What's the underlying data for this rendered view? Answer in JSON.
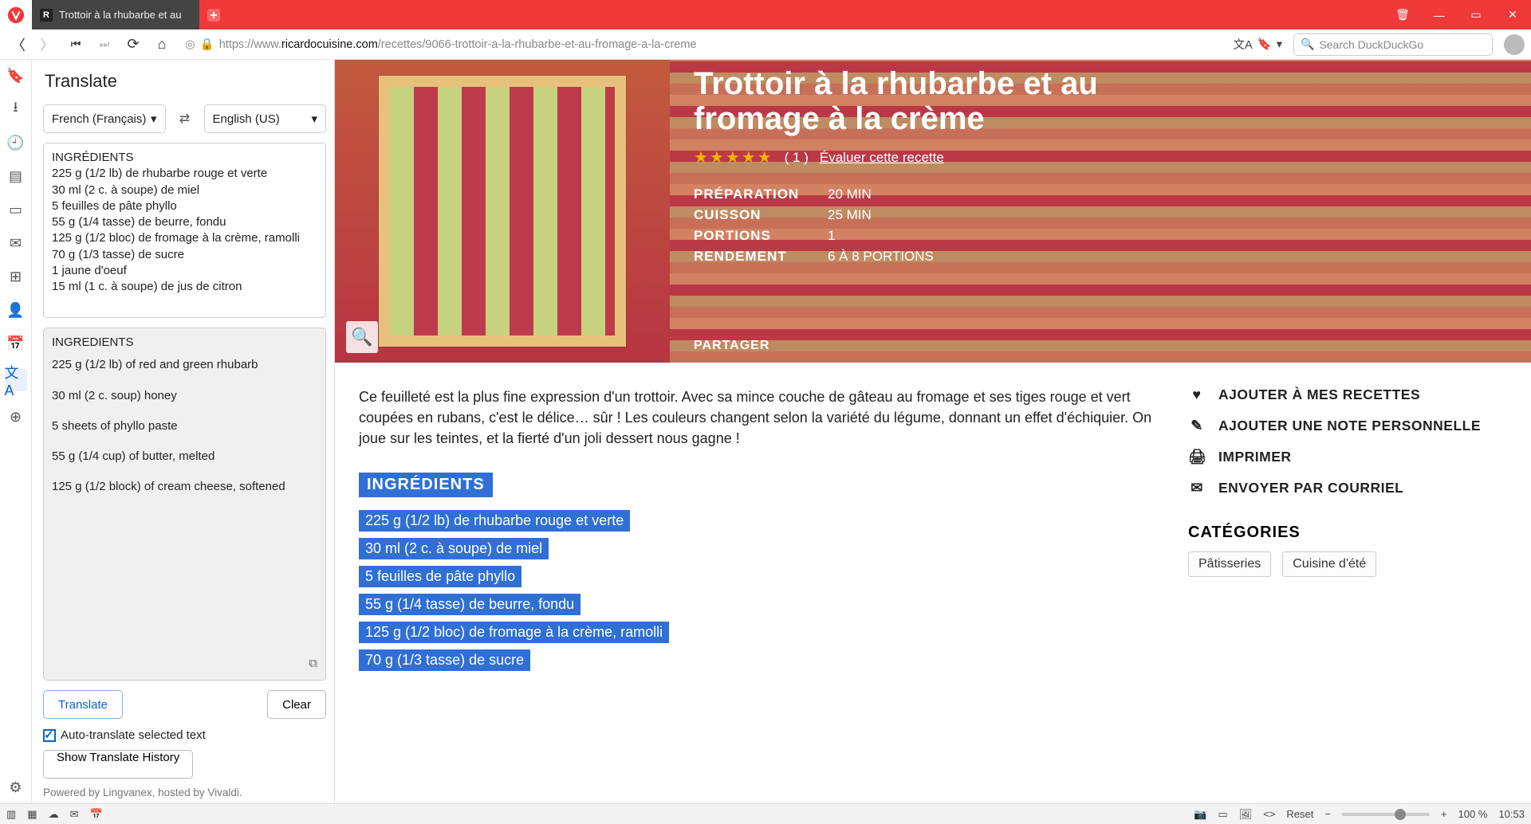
{
  "titlebar": {
    "tab_title": "Trottoir à la rhubarbe et au",
    "favicon_letter": "R"
  },
  "addr": {
    "url_prefix": "https://www.",
    "url_domain": "ricardocuisine.com",
    "url_path": "/recettes/9066-trottoir-a-la-rhubarbe-et-au-fromage-a-la-creme",
    "search_placeholder": "Search DuckDuckGo"
  },
  "panel": {
    "title": "Translate",
    "from_lang": "French (Français)",
    "to_lang": "English (US)",
    "src_heading": "INGRÉDIENTS",
    "src_lines": [
      "225 g (1/2 lb) de rhubarbe rouge et verte",
      "30 ml (2 c. à soupe) de miel",
      "5 feuilles de pâte phyllo",
      "55 g (1/4 tasse) de beurre, fondu",
      "125 g (1/2 bloc) de fromage à la crème, ramolli",
      "70 g (1/3 tasse) de sucre",
      "1 jaune d'oeuf",
      "15 ml (1 c. à soupe) de jus de citron"
    ],
    "dst_heading": "INGREDIENTS",
    "dst_lines": [
      "225 g (1/2 lb) of red and green rhubarb",
      "30 ml (2 c. soup) honey",
      "5 sheets of phyllo paste",
      "55 g (1/4 cup) of butter, melted",
      "125 g (1/2 block) of cream cheese, softened"
    ],
    "translate_btn": "Translate",
    "clear_btn": "Clear",
    "auto_label": "Auto-translate selected text",
    "history_btn": "Show Translate History",
    "powered": "Powered by Lingvanex, hosted by Vivaldi."
  },
  "hero": {
    "title": "Trottoir à la rhubarbe et au fromage à la crème",
    "rating_count": "( 1 )",
    "eval": "Évaluer cette recette",
    "prep_label": "PRÉPARATION",
    "prep_val": "20 MIN",
    "cook_label": "CUISSON",
    "cook_val": "25 MIN",
    "port_label": "PORTIONS",
    "port_val": "1",
    "yield_label": "RENDEMENT",
    "yield_val": "6 À 8 PORTIONS",
    "share": "PARTAGER"
  },
  "body": {
    "desc": "Ce feuilleté est la plus fine expression d'un trottoir. Avec sa mince couche de gâteau au fromage et ses tiges rouge et vert coupées en rubans, c'est le délice… sûr ! Les couleurs changent selon la variété du légume, donnant un effet d'échiquier. On joue sur les teintes, et la fierté d'un joli dessert nous gagne !",
    "ing_heading": "INGRÉDIENTS",
    "ingredients": [
      "225 g (1/2 lb) de rhubarbe rouge et verte",
      "30 ml (2 c. à soupe) de miel",
      "5 feuilles de pâte phyllo",
      "55 g (1/4 tasse) de beurre, fondu",
      "125 g (1/2 bloc) de fromage à la crème, ramolli",
      "70 g (1/3 tasse) de sucre"
    ],
    "actions": {
      "fav": "AJOUTER À MES RECETTES",
      "note": "AJOUTER UNE NOTE PERSONNELLE",
      "print": "IMPRIMER",
      "mail": "ENVOYER PAR COURRIEL"
    },
    "cats_heading": "CATÉGORIES",
    "tags": [
      "Pâtisseries",
      "Cuisine d'été"
    ]
  },
  "status": {
    "reset": "Reset",
    "zoom": "100 %",
    "time": "10:53"
  }
}
